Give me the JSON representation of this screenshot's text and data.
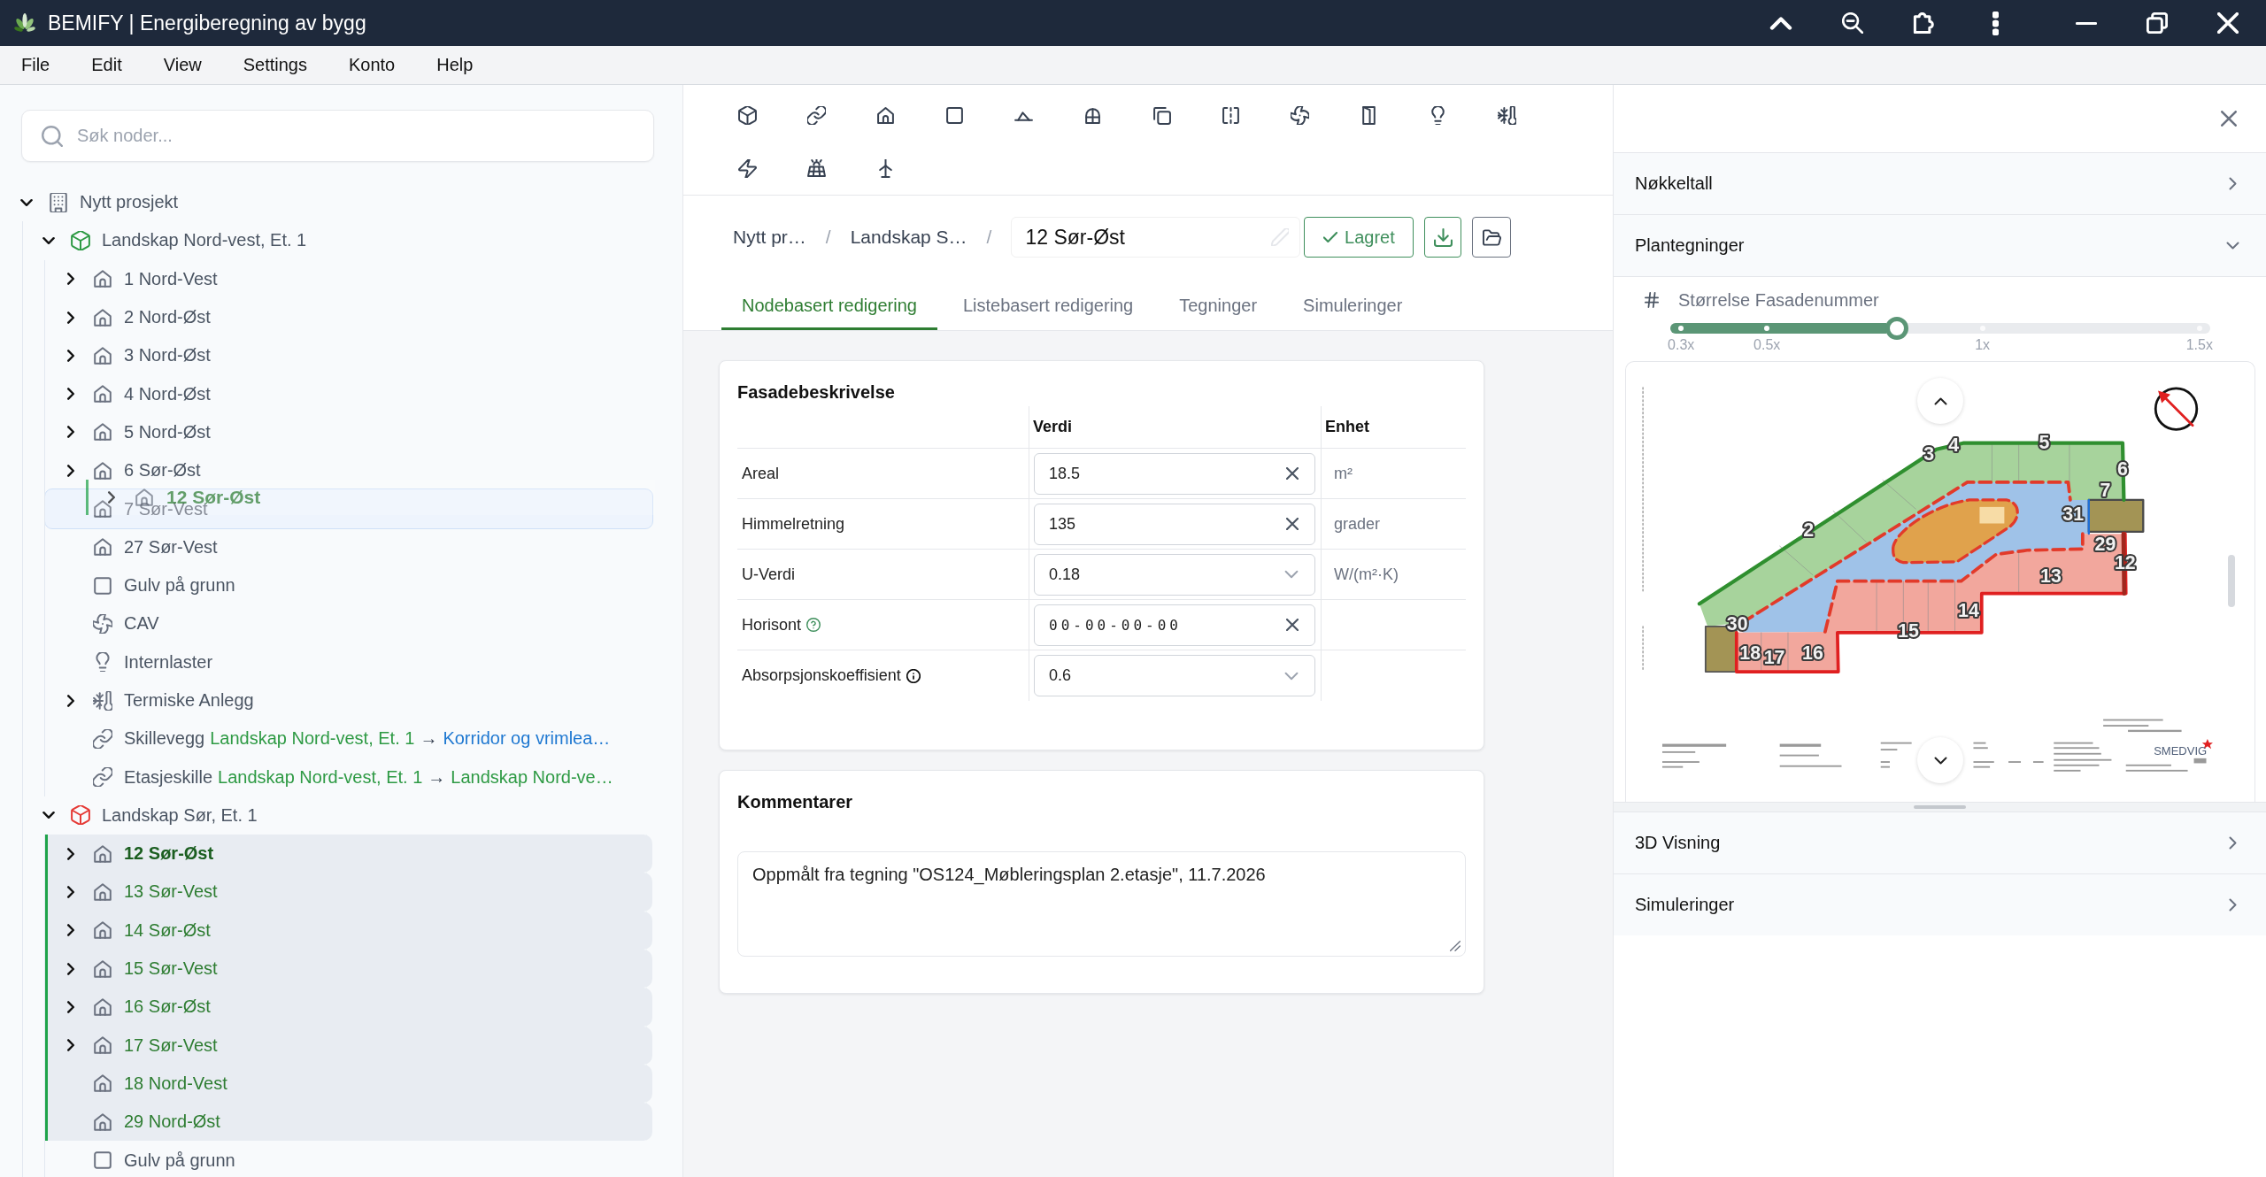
{
  "window": {
    "title": "BEMIFY | Energiberegning av bygg"
  },
  "menu": [
    "File",
    "Edit",
    "View",
    "Settings",
    "Konto",
    "Help"
  ],
  "sidebar": {
    "search": {
      "placeholder": "Søk noder..."
    },
    "tree": [
      {
        "label": "Nytt prosjekt",
        "kind": "project",
        "expanded": true,
        "selected": false,
        "active": false,
        "drop_target": false,
        "children": [
          {
            "label": "Landskap Nord-vest, Et. 1",
            "kind": "zone",
            "color": "#2e9a44",
            "expanded": true,
            "selected": false,
            "active": false,
            "drop_target": false,
            "children": [
              {
                "label": "1 Nord-Vest",
                "kind": "room",
                "expanded": false,
                "selected": false,
                "active": false,
                "drop_target": false
              },
              {
                "label": "2 Nord-Øst",
                "kind": "room",
                "expanded": false,
                "selected": false,
                "active": false,
                "drop_target": false
              },
              {
                "label": "3 Nord-Øst",
                "kind": "room",
                "expanded": false,
                "selected": false,
                "active": false,
                "drop_target": false
              },
              {
                "label": "4 Nord-Øst",
                "kind": "room",
                "expanded": false,
                "selected": false,
                "active": false,
                "drop_target": false
              },
              {
                "label": "5 Nord-Øst",
                "kind": "room",
                "expanded": false,
                "selected": false,
                "active": false,
                "drop_target": false
              },
              {
                "label": "6 Sør-Øst",
                "kind": "room",
                "expanded": false,
                "selected": false,
                "active": false,
                "drop_target": false
              },
              {
                "label": "7 Sør-Vest",
                "kind": "room",
                "selected": false,
                "active": false,
                "drop_target": true
              },
              {
                "label": "27 Sør-Vest",
                "kind": "room",
                "selected": false,
                "active": false,
                "drop_target": false
              },
              {
                "label": "Gulv på grunn",
                "kind": "floor",
                "selected": false,
                "active": false,
                "drop_target": false
              },
              {
                "label": "CAV",
                "kind": "ventilation",
                "selected": false,
                "active": false,
                "drop_target": false
              },
              {
                "label": "Internlaster",
                "kind": "loads",
                "selected": false,
                "active": false,
                "drop_target": false
              },
              {
                "label": "Termiske Anlegg",
                "kind": "thermal",
                "expanded": false,
                "selected": false,
                "active": false,
                "drop_target": false
              },
              {
                "label": "Skillevegg",
                "kind": "link",
                "from": {
                  "text": "Landskap Nord-vest, Et. 1",
                  "color": "#2e9a44"
                },
                "arrow": "→",
                "to": {
                  "text": "Korridor og vrimlea…",
                  "color": "#1f78d1"
                },
                "selected": false,
                "active": false,
                "drop_target": false
              },
              {
                "label": "Etasjeskille",
                "kind": "link",
                "from": {
                  "text": "Landskap Nord-vest, Et. 1",
                  "color": "#2e9a44"
                },
                "arrow": "→",
                "to": {
                  "text": "Landskap Nord-ve…",
                  "color": "#2e9a44"
                },
                "selected": false,
                "active": false,
                "drop_target": false
              }
            ]
          },
          {
            "label": "Landskap Sør, Et. 1",
            "kind": "zone",
            "color": "#e53935",
            "expanded": true,
            "selected": false,
            "active": false,
            "drop_target": false,
            "children": [
              {
                "label": "12 Sør-Øst",
                "kind": "room",
                "expanded": false,
                "selected": true,
                "active": true,
                "drop_target": false
              },
              {
                "label": "13 Sør-Vest",
                "kind": "room",
                "expanded": false,
                "selected": true,
                "active": false,
                "drop_target": false
              },
              {
                "label": "14 Sør-Øst",
                "kind": "room",
                "expanded": false,
                "selected": true,
                "active": false,
                "drop_target": false
              },
              {
                "label": "15 Sør-Vest",
                "kind": "room",
                "expanded": false,
                "selected": true,
                "active": false,
                "drop_target": false
              },
              {
                "label": "16 Sør-Øst",
                "kind": "room",
                "expanded": false,
                "selected": true,
                "active": false,
                "drop_target": false
              },
              {
                "label": "17 Sør-Vest",
                "kind": "room",
                "expanded": false,
                "selected": true,
                "active": false,
                "drop_target": false
              },
              {
                "label": "18 Nord-Vest",
                "kind": "room",
                "selected": true,
                "active": false,
                "drop_target": false
              },
              {
                "label": "29 Nord-Øst",
                "kind": "room",
                "selected": true,
                "active": false,
                "drop_target": false
              },
              {
                "label": "Gulv på grunn",
                "kind": "floor",
                "selected": false,
                "active": false,
                "drop_target": false
              }
            ]
          }
        ]
      }
    ],
    "drag_ghost": {
      "label": "12 Sør-Øst",
      "kind": "room",
      "expanded": false
    }
  },
  "breadcrumb": {
    "crumbs": [
      {
        "label": "Nytt pr…",
        "separator": "/"
      },
      {
        "label": "Landskap S…",
        "separator": "/"
      }
    ],
    "name_field": {
      "value": "12 Sør-Øst"
    },
    "save_button": {
      "label": "Lagret"
    }
  },
  "tabs": [
    {
      "label": "Nodebasert redigering",
      "selected": true
    },
    {
      "label": "Listebasert redigering",
      "selected": false
    },
    {
      "label": "Tegninger",
      "selected": false
    },
    {
      "label": "Simuleringer",
      "selected": false
    }
  ],
  "facade_card": {
    "title": "Fasadebeskrivelse",
    "columns": [
      "Verdi",
      "Enhet"
    ],
    "rows": [
      {
        "label": "Areal",
        "kind": "input",
        "value": "18.5",
        "unit": "m²"
      },
      {
        "label": "Himmelretning",
        "kind": "input",
        "value": "135",
        "unit": "grader"
      },
      {
        "label": "U-Verdi",
        "kind": "select",
        "value": "0.18",
        "unit": "W/(m²·K)"
      },
      {
        "label": "Horisont",
        "kind": "masked",
        "value": "00-00-00-00",
        "hint": {
          "kind": "help"
        }
      },
      {
        "label": "Absorpsjonskoeffisient",
        "kind": "select",
        "value": "0.6",
        "hint": {
          "kind": "info"
        }
      }
    ]
  },
  "comments_card": {
    "title": "Kommentarer",
    "text": "Oppmålt fra tegning \"OS124_Møbleringsplan 2.etasje\", 11.7.2026"
  },
  "right_panel": {
    "sections": [
      {
        "title": "Nøkkeltall",
        "expanded": false
      },
      {
        "title": "Plantegninger",
        "expanded": true,
        "slider": {
          "label": "Størrelse Fasadenummer",
          "level": 0.42,
          "ticks": [
            "0.3x",
            "0.5x",
            "1x",
            "1.5x"
          ]
        },
        "floor_plan": {
          "facade_numbers": [
            "3",
            "4",
            "5",
            "6",
            "7",
            "31",
            "2",
            "29",
            "12",
            "13",
            "14",
            "30",
            "15",
            "18",
            "17",
            "16"
          ],
          "logo": "SMEDVIG"
        }
      },
      {
        "title": "3D Visning",
        "expanded": false
      },
      {
        "title": "Simuleringer",
        "expanded": false
      }
    ]
  }
}
